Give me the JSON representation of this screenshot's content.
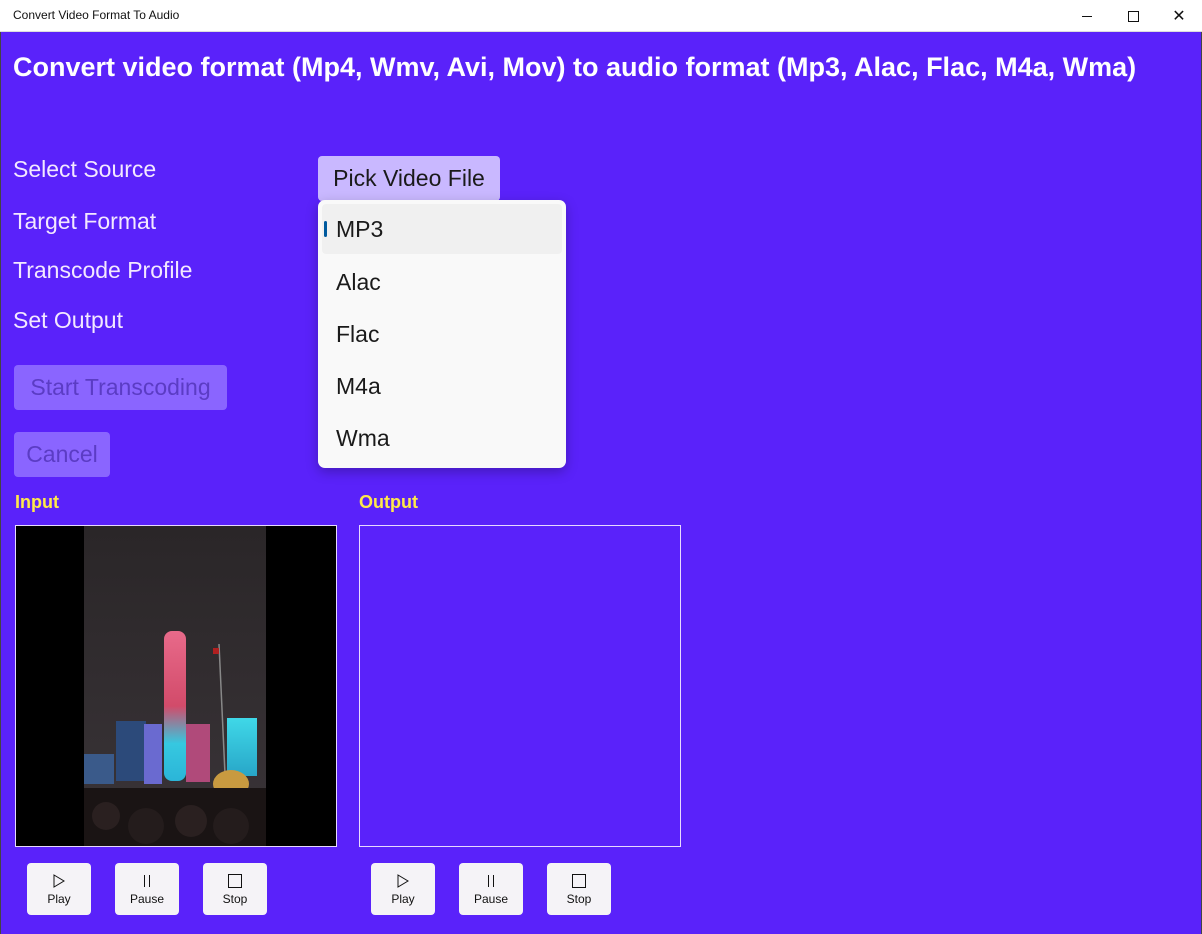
{
  "window": {
    "title": "Convert Video Format To Audio",
    "controls": [
      "minimize",
      "maximize",
      "close"
    ]
  },
  "header": {
    "title": "Convert video format (Mp4, Wmv, Avi, Mov) to audio format (Mp3, Alac, Flac, M4a, Wma)"
  },
  "form": {
    "select_source_label": "Select Source",
    "target_format_label": "Target Format",
    "transcode_profile_label": "Transcode Profile",
    "set_output_label": "Set Output",
    "pick_video_button": "Pick Video File",
    "start_button": "Start Transcoding",
    "cancel_button": "Cancel"
  },
  "format_dropdown": {
    "selected": "MP3",
    "options": [
      "MP3",
      "Alac",
      "Flac",
      "M4a",
      "Wma"
    ]
  },
  "input_panel": {
    "label": "Input",
    "media": "night city skyline video frame",
    "controls": [
      {
        "label": "Play",
        "icon": "play-icon"
      },
      {
        "label": "Pause",
        "icon": "pause-icon"
      },
      {
        "label": "Stop",
        "icon": "stop-icon"
      }
    ]
  },
  "output_panel": {
    "label": "Output",
    "controls": [
      {
        "label": "Play",
        "icon": "play-icon"
      },
      {
        "label": "Pause",
        "icon": "pause-icon"
      },
      {
        "label": "Stop",
        "icon": "stop-icon"
      }
    ]
  },
  "colors": {
    "background": "#5a22fa",
    "section_label": "#ffe94a",
    "pick_button": "#c9b8ff",
    "disabled_button": "#8a65ff",
    "dropdown_bg": "#f9f9f9",
    "selection_indicator": "#005a9e"
  }
}
